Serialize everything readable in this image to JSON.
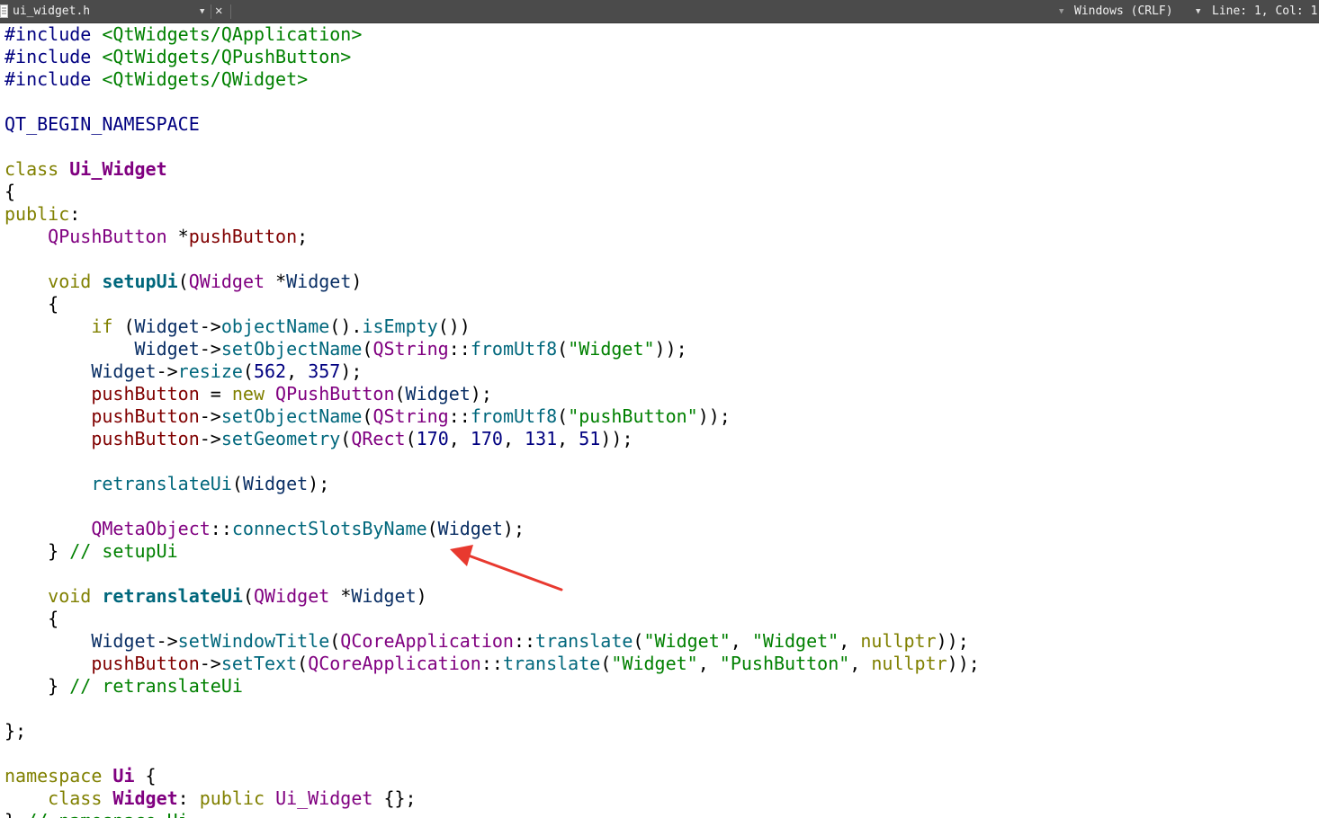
{
  "tab": {
    "filename": "ui_widget.h",
    "line_endings": "Windows (CRLF)",
    "cursor_position": "Line: 1, Col: 1"
  },
  "code": [
    [
      [
        "pp",
        "#include "
      ],
      [
        "inc",
        "<QtWidgets/QApplication>"
      ]
    ],
    [
      [
        "pp",
        "#include "
      ],
      [
        "inc",
        "<QtWidgets/QPushButton>"
      ]
    ],
    [
      [
        "pp",
        "#include "
      ],
      [
        "inc",
        "<QtWidgets/QWidget>"
      ]
    ],
    [],
    [
      [
        "mac",
        "QT_BEGIN_NAMESPACE"
      ]
    ],
    [],
    [
      [
        "kw",
        "class "
      ],
      [
        "cls",
        "Ui_Widget"
      ]
    ],
    [
      [
        "",
        "{"
      ]
    ],
    [
      [
        "kw",
        "public"
      ],
      [
        "",
        ":"
      ]
    ],
    [
      [
        "",
        "    "
      ],
      [
        "typ",
        "QPushButton"
      ],
      [
        "",
        " *"
      ],
      [
        "mem",
        "pushButton"
      ],
      [
        "",
        ";"
      ]
    ],
    [],
    [
      [
        "",
        "    "
      ],
      [
        "kw",
        "void "
      ],
      [
        "def",
        "setupUi"
      ],
      [
        "",
        "("
      ],
      [
        "typ",
        "QWidget"
      ],
      [
        "",
        " *"
      ],
      [
        "prm",
        "Widget"
      ],
      [
        "",
        ")"
      ]
    ],
    [
      [
        "",
        "    {"
      ]
    ],
    [
      [
        "",
        "        "
      ],
      [
        "kw",
        "if"
      ],
      [
        "",
        " ("
      ],
      [
        "prm",
        "Widget"
      ],
      [
        "",
        "->"
      ],
      [
        "fn",
        "objectName"
      ],
      [
        "",
        "()."
      ],
      [
        "fn",
        "isEmpty"
      ],
      [
        "",
        "())"
      ]
    ],
    [
      [
        "",
        "            "
      ],
      [
        "prm",
        "Widget"
      ],
      [
        "",
        "->"
      ],
      [
        "fn",
        "setObjectName"
      ],
      [
        "",
        "("
      ],
      [
        "typ",
        "QString"
      ],
      [
        "",
        "::"
      ],
      [
        "fn",
        "fromUtf8"
      ],
      [
        "",
        "("
      ],
      [
        "str",
        "\"Widget\""
      ],
      [
        "",
        "));"
      ]
    ],
    [
      [
        "",
        "        "
      ],
      [
        "prm",
        "Widget"
      ],
      [
        "",
        "->"
      ],
      [
        "fn",
        "resize"
      ],
      [
        "",
        "("
      ],
      [
        "num",
        "562"
      ],
      [
        "",
        ", "
      ],
      [
        "num",
        "357"
      ],
      [
        "",
        ");"
      ]
    ],
    [
      [
        "",
        "        "
      ],
      [
        "mem",
        "pushButton"
      ],
      [
        "",
        " = "
      ],
      [
        "kw",
        "new "
      ],
      [
        "typ",
        "QPushButton"
      ],
      [
        "",
        "("
      ],
      [
        "prm",
        "Widget"
      ],
      [
        "",
        ");"
      ]
    ],
    [
      [
        "",
        "        "
      ],
      [
        "mem",
        "pushButton"
      ],
      [
        "",
        "->"
      ],
      [
        "fn",
        "setObjectName"
      ],
      [
        "",
        "("
      ],
      [
        "typ",
        "QString"
      ],
      [
        "",
        "::"
      ],
      [
        "fn",
        "fromUtf8"
      ],
      [
        "",
        "("
      ],
      [
        "str",
        "\"pushButton\""
      ],
      [
        "",
        "));"
      ]
    ],
    [
      [
        "",
        "        "
      ],
      [
        "mem",
        "pushButton"
      ],
      [
        "",
        "->"
      ],
      [
        "fn",
        "setGeometry"
      ],
      [
        "",
        "("
      ],
      [
        "typ",
        "QRect"
      ],
      [
        "",
        "("
      ],
      [
        "num",
        "170"
      ],
      [
        "",
        ", "
      ],
      [
        "num",
        "170"
      ],
      [
        "",
        ", "
      ],
      [
        "num",
        "131"
      ],
      [
        "",
        ", "
      ],
      [
        "num",
        "51"
      ],
      [
        "",
        "));"
      ]
    ],
    [],
    [
      [
        "",
        "        "
      ],
      [
        "fn",
        "retranslateUi"
      ],
      [
        "",
        "("
      ],
      [
        "prm",
        "Widget"
      ],
      [
        "",
        ");"
      ]
    ],
    [],
    [
      [
        "",
        "        "
      ],
      [
        "typ",
        "QMetaObject"
      ],
      [
        "",
        "::"
      ],
      [
        "fn",
        "connectSlotsByName"
      ],
      [
        "",
        "("
      ],
      [
        "prm",
        "Widget"
      ],
      [
        "",
        ");"
      ]
    ],
    [
      [
        "",
        "    } "
      ],
      [
        "cmt",
        "// setupUi"
      ]
    ],
    [],
    [
      [
        "",
        "    "
      ],
      [
        "kw",
        "void "
      ],
      [
        "def",
        "retranslateUi"
      ],
      [
        "",
        "("
      ],
      [
        "typ",
        "QWidget"
      ],
      [
        "",
        " *"
      ],
      [
        "prm",
        "Widget"
      ],
      [
        "",
        ")"
      ]
    ],
    [
      [
        "",
        "    {"
      ]
    ],
    [
      [
        "",
        "        "
      ],
      [
        "prm",
        "Widget"
      ],
      [
        "",
        "->"
      ],
      [
        "fn",
        "setWindowTitle"
      ],
      [
        "",
        "("
      ],
      [
        "typ",
        "QCoreApplication"
      ],
      [
        "",
        "::"
      ],
      [
        "fn",
        "translate"
      ],
      [
        "",
        "("
      ],
      [
        "str",
        "\"Widget\""
      ],
      [
        "",
        ", "
      ],
      [
        "str",
        "\"Widget\""
      ],
      [
        "",
        ", "
      ],
      [
        "kw",
        "nullptr"
      ],
      [
        "",
        "));"
      ]
    ],
    [
      [
        "",
        "        "
      ],
      [
        "mem",
        "pushButton"
      ],
      [
        "",
        "->"
      ],
      [
        "fn",
        "setText"
      ],
      [
        "",
        "("
      ],
      [
        "typ",
        "QCoreApplication"
      ],
      [
        "",
        "::"
      ],
      [
        "fn",
        "translate"
      ],
      [
        "",
        "("
      ],
      [
        "str",
        "\"Widget\""
      ],
      [
        "",
        ", "
      ],
      [
        "str",
        "\"PushButton\""
      ],
      [
        "",
        ", "
      ],
      [
        "kw",
        "nullptr"
      ],
      [
        "",
        "));"
      ]
    ],
    [
      [
        "",
        "    } "
      ],
      [
        "cmt",
        "// retranslateUi"
      ]
    ],
    [],
    [
      [
        "",
        "};"
      ]
    ],
    [],
    [
      [
        "kw",
        "namespace "
      ],
      [
        "cls",
        "Ui"
      ],
      [
        "",
        " {"
      ]
    ],
    [
      [
        "",
        "    "
      ],
      [
        "kw",
        "class "
      ],
      [
        "cls",
        "Widget"
      ],
      [
        "",
        ": "
      ],
      [
        "kw",
        "public "
      ],
      [
        "typ",
        "Ui_Widget"
      ],
      [
        "",
        " {};"
      ]
    ],
    [
      [
        "",
        "} "
      ],
      [
        "cmt",
        "// namespace Ui"
      ]
    ]
  ],
  "colors": {
    "toolbar_bg": "#4b4b4b",
    "annotation_arrow": "#e8392f"
  }
}
